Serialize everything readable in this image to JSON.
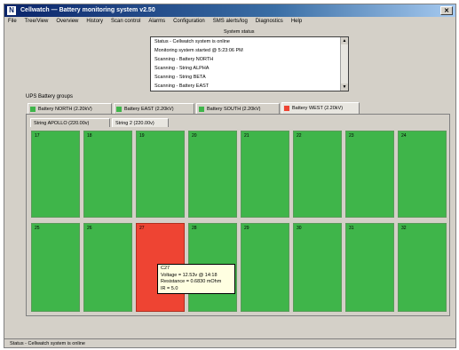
{
  "window": {
    "title": "Cellwatch — Battery monitoring system v2.50",
    "close_symbol": "✕"
  },
  "menu": [
    "File",
    "Tree/View",
    "Overview",
    "History",
    "Scan control",
    "Alarms",
    "Configuration",
    "SMS alerts/log",
    "Diagnostics",
    "Help"
  ],
  "system_status": {
    "label": "System status",
    "lines": [
      "Status - Cellwatch system is online",
      "Monitoring system started @ 5:23:06 PM",
      "Scanning - Battery NORTH",
      "Scanning - String ALPHA",
      "Scanning - String BETA",
      "Scanning - Battery EAST"
    ]
  },
  "group_label": "UPS Battery groups",
  "battery_tabs": [
    {
      "label": "Battery NORTH (2.20kV)",
      "status": "ok"
    },
    {
      "label": "Battery EAST (2.20kV)",
      "status": "ok"
    },
    {
      "label": "Battery SOUTH (2.20kV)",
      "status": "ok"
    },
    {
      "label": "Battery WEST (2.20kV)",
      "status": "alarm",
      "active": true
    }
  ],
  "string_tabs": [
    {
      "label": "String APOLLO (220.00v)"
    },
    {
      "label": "String 2 (220.00v)",
      "active": true
    }
  ],
  "colors": {
    "ok": "#3fb54a",
    "alarm": "#ee4433"
  },
  "cells": {
    "row1": [
      {
        "num": "17",
        "status": "ok"
      },
      {
        "num": "18",
        "status": "ok"
      },
      {
        "num": "19",
        "status": "ok"
      },
      {
        "num": "20",
        "status": "ok"
      },
      {
        "num": "21",
        "status": "ok"
      },
      {
        "num": "22",
        "status": "ok"
      },
      {
        "num": "23",
        "status": "ok"
      },
      {
        "num": "24",
        "status": "ok"
      }
    ],
    "row2": [
      {
        "num": "25",
        "status": "ok"
      },
      {
        "num": "26",
        "status": "ok"
      },
      {
        "num": "27",
        "status": "alarm"
      },
      {
        "num": "28",
        "status": "ok"
      },
      {
        "num": "29",
        "status": "ok"
      },
      {
        "num": "30",
        "status": "ok"
      },
      {
        "num": "31",
        "status": "ok"
      },
      {
        "num": "32",
        "status": "ok"
      }
    ]
  },
  "tooltip": {
    "lines": [
      "C27",
      "Voltage = 12.53v @ 14:18",
      "Resistance = 0.6830 mOhm",
      "IR = 5.0"
    ]
  },
  "statusbar": {
    "text": "Status - Cellwatch system is online"
  }
}
